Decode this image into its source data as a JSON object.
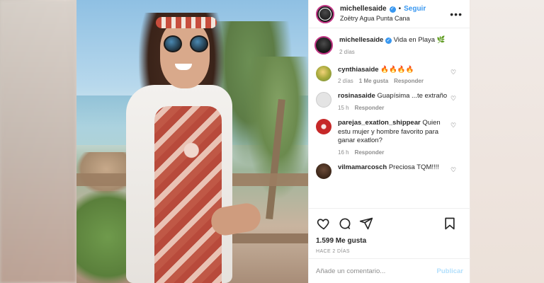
{
  "post": {
    "username": "michellesaide",
    "follow_label": "Seguir",
    "dot": "•",
    "location": "Zoëtry Agua Punta Cana",
    "more": "•••"
  },
  "caption": {
    "username": "michellesaide",
    "text": "Vida en Playa 🌿",
    "time": "2 días"
  },
  "comments": [
    {
      "username": "cynthiasaide",
      "text": "🔥🔥🔥🔥",
      "time": "2 días",
      "likes": "1 Me gusta",
      "reply": "Responder"
    },
    {
      "username": "rosinasaide",
      "text": "Guapísima ...te extraño",
      "time": "15 h",
      "reply": "Responder"
    },
    {
      "username": "parejas_exatlon_shippear",
      "text": "Quien estu mujer y hombre favorito para ganar exatlon?",
      "time": "16 h",
      "reply": "Responder"
    },
    {
      "username": "vilmamarcosch",
      "text": "Preciosa TQM!!!!"
    }
  ],
  "stats": {
    "likes": "1.599 Me gusta",
    "date": "HACE 2 DÍAS"
  },
  "compose": {
    "placeholder": "Añade un comentario...",
    "publish": "Publicar"
  },
  "icons": {
    "like": "heart-icon",
    "comment": "comment-icon",
    "share": "share-icon",
    "save": "bookmark-icon",
    "more": "more-icon",
    "verified": "verified-icon"
  },
  "colors": {
    "link_blue": "#3897f0",
    "text": "#262626",
    "muted": "#8e8e8e",
    "publish_disabled": "#b2dffc"
  }
}
